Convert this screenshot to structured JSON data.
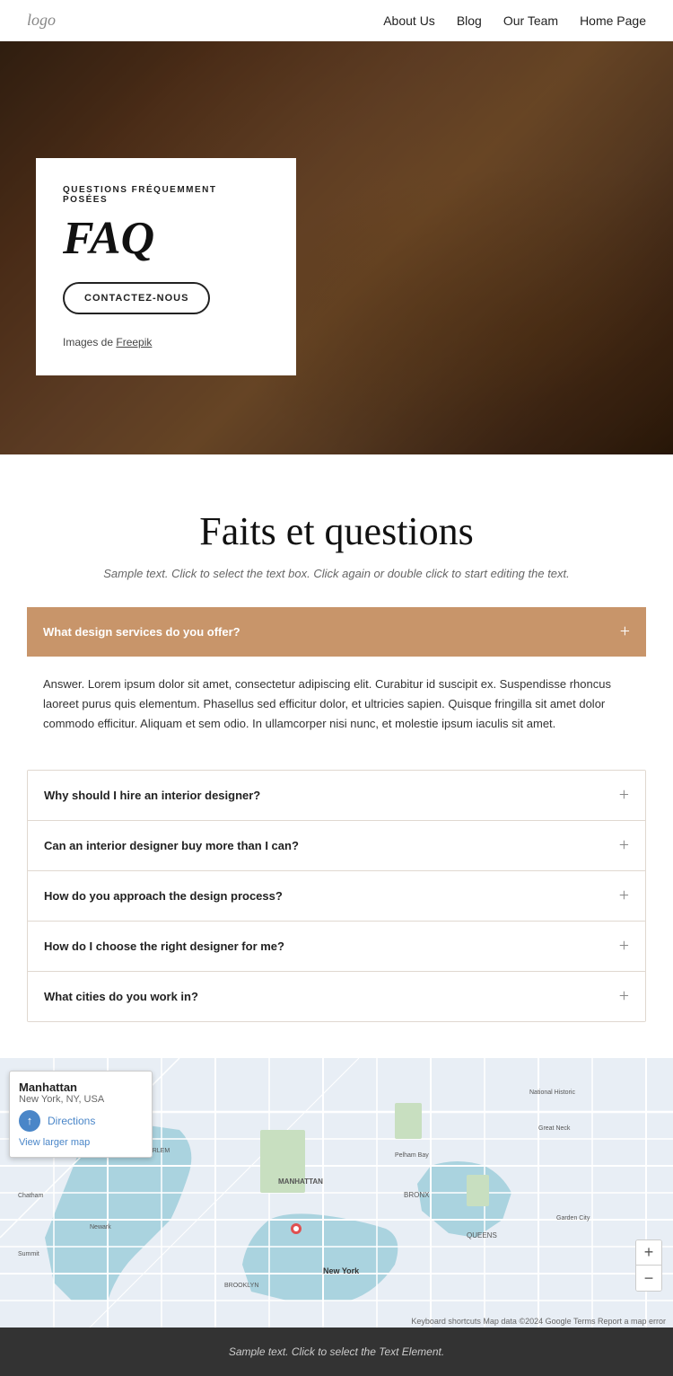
{
  "nav": {
    "logo": "logo",
    "links": [
      {
        "label": "About Us",
        "href": "#"
      },
      {
        "label": "Blog",
        "href": "#"
      },
      {
        "label": "Our Team",
        "href": "#"
      },
      {
        "label": "Home Page",
        "href": "#"
      }
    ]
  },
  "hero": {
    "subtitle": "QUESTIONS FRÉQUEMMENT POSÉES",
    "title": "FAQ",
    "button_label": "CONTACTEZ-NOUS",
    "credit_prefix": "Images de ",
    "credit_link": "Freepik"
  },
  "faq_section": {
    "heading": "Faits et questions",
    "subtext": "Sample text. Click to select the text box. Click again or double click to start editing the text.",
    "first_question": "What design services do you offer?",
    "answer": "Answer. Lorem ipsum dolor sit amet, consectetur adipiscing elit. Curabitur id suscipit ex. Suspendisse rhoncus laoreet purus quis elementum. Phasellus sed efficitur dolor, et ultricies sapien. Quisque fringilla sit amet dolor commodo efficitur. Aliquam et sem odio. In ullamcorper nisi nunc, et molestie ipsum iaculis sit amet.",
    "other_questions": [
      "Why should I hire an interior designer?",
      "Can an interior designer buy more than I can?",
      "How do you approach the design process?",
      "How do I choose the right designer for me?",
      "What cities do you work in?"
    ]
  },
  "map": {
    "place_name": "Manhattan",
    "address_line1": "New York, NY, USA",
    "directions_label": "Directions",
    "view_larger": "View larger map",
    "attribution": "Keyboard shortcuts   Map data ©2024 Google   Terms   Report a map error",
    "zoom_in": "+",
    "zoom_out": "−"
  },
  "footer": {
    "text": "Sample text. Click to select the Text Element."
  }
}
